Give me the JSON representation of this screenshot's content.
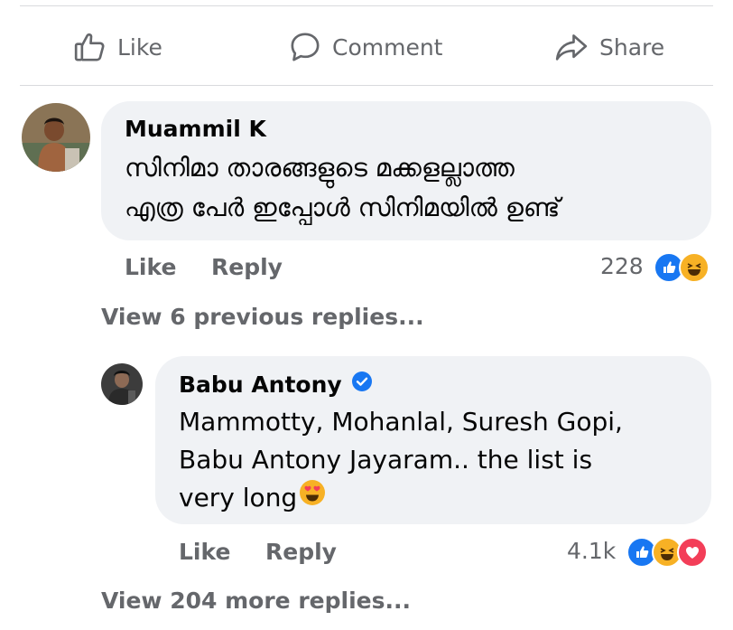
{
  "action_bar": {
    "like_label": "Like",
    "comment_label": "Comment",
    "share_label": "Share"
  },
  "comments": [
    {
      "author": "Muammil K",
      "lines": [
        "സിനിമാ താരങ്ങളുടെ മക്കളല്ലാത്ത",
        "എത്ര പേർ ഇപ്പോൾ സിനിമയിൽ ഉണ്ട്"
      ],
      "like_label": "Like",
      "reply_label": "Reply",
      "reaction_count": "228",
      "reactions": [
        "like",
        "haha"
      ]
    }
  ],
  "view_previous_replies": "View 6 previous replies...",
  "reply": {
    "author": "Babu Antony",
    "verified": true,
    "lines": [
      "Mammotty, Mohanlal, Suresh Gopi,",
      "Babu Antony Jayaram.. the list is",
      "very long"
    ],
    "emoji": "heart-eyes",
    "like_label": "Like",
    "reply_label": "Reply",
    "reaction_count": "4.1k",
    "reactions": [
      "like",
      "haha",
      "love"
    ]
  },
  "view_more_replies": "View 204 more replies...",
  "colors": {
    "like_blue": "#1877f2",
    "love_red": "#f33e58",
    "haha_yellow": "#f7b125",
    "bubble_bg": "#f0f2f5",
    "muted_text": "#65676b"
  }
}
